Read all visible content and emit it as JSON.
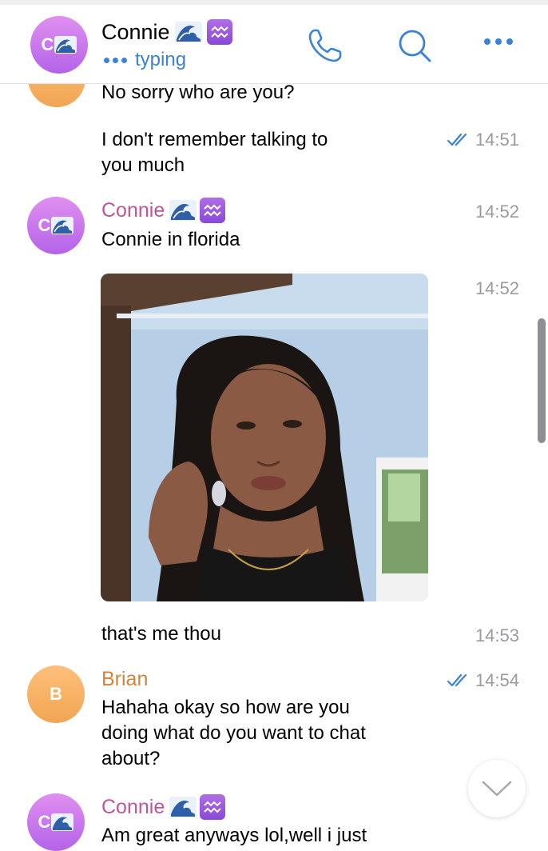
{
  "header": {
    "avatar_letter": "C",
    "name": "Connie",
    "status": "typing"
  },
  "messages": [
    {
      "text": "No sorry who are you?"
    },
    {
      "text_lines": [
        "I don't remember talking to",
        "you much"
      ],
      "time": "14:51"
    },
    {
      "sender": "Connie",
      "avatar_letter": "C",
      "text": "Connie in florida",
      "time": "14:52"
    },
    {
      "time": "14:52"
    },
    {
      "text": "that's me thou",
      "time": "14:53"
    },
    {
      "sender": "Brian",
      "avatar_letter": "B",
      "text_lines": [
        "Hahaha okay so how are you",
        "doing what do you want to chat",
        "about?"
      ],
      "time": "14:54"
    },
    {
      "sender": "Connie",
      "avatar_letter": "C",
      "text": "Am great anyways lol,well i just"
    }
  ],
  "colors": {
    "accent": "#3a82d6",
    "connie_name": "#c0559a",
    "brian_name": "#d48437",
    "timestamp": "#9a9aa0"
  }
}
